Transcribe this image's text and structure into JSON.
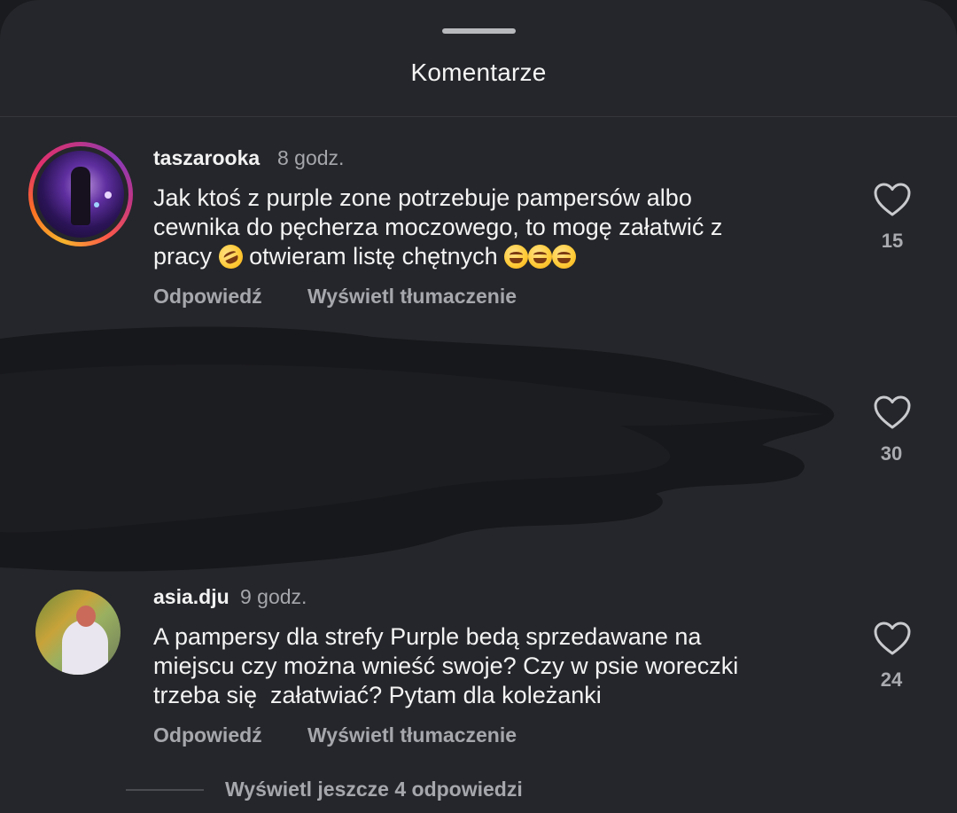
{
  "sheet": {
    "title": "Komentarze"
  },
  "comments": [
    {
      "username": "taszarooka",
      "time": "8 godz.",
      "lines": [
        "Jak ktoś z purple zone potrzebuje pampersów albo",
        "cewnika do pęcherza moczowego, to mogę załatwić z"
      ],
      "line3_start": "pracy",
      "line3_end": "otwieram listę chętnych",
      "likes": "15",
      "reply_label": "Odpowiedź",
      "translate_label": "Wyświetl tłumaczenie"
    },
    {
      "redacted": true,
      "likes": "30"
    },
    {
      "username": "asia.dju",
      "time": "9 godz.",
      "lines": [
        "A pampersy dla strefy Purple bedą sprzedawane na",
        "miejscu czy można wnieść swoje? Czy w psie woreczki",
        "trzeba się  załatwiać? Pytam dla koleżanki"
      ],
      "likes": "24",
      "reply_label": "Odpowiedź",
      "translate_label": "Wyświetl tłumaczenie"
    }
  ],
  "footer": {
    "view_more_replies": "Wyświetl jeszcze 4 odpowiedzi"
  },
  "icons": {
    "like": "heart-outline-icon",
    "emoji_rofl": "rolling-on-floor-laughing-emoji",
    "emoji_grin": "grinning-squinting-face-emoji"
  },
  "colors": {
    "background": "#25262b",
    "text_primary": "#f3f3f3",
    "text_secondary": "#a5a7ad"
  }
}
